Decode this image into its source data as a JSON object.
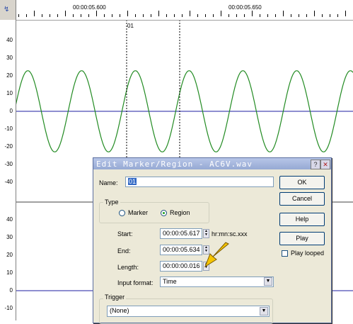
{
  "ruler": {
    "corner_icon": "cursor-icon",
    "time_labels": [
      "00:00:05.600",
      "00:00:05.650"
    ],
    "marker_label": "01"
  },
  "waveform": {
    "top_axis": [
      "40",
      "30",
      "20",
      "10",
      "0",
      "-10",
      "-20",
      "-30",
      "-40"
    ],
    "bottom_axis": [
      "40",
      "30",
      "20",
      "10",
      "0",
      "-10"
    ],
    "wave_color": "#228b22",
    "baseline_color": "#1e1ea0",
    "amplitude_peak": 23
  },
  "dialog": {
    "title": "Edit Marker/Region - AC6V.wav",
    "name_label": "Name:",
    "name_value": "01",
    "type_group": "Type",
    "type_options": [
      "Marker",
      "Region"
    ],
    "type_selected": "Region",
    "start_label": "Start:",
    "start_value": "00:00:05.617",
    "start_hint": "hr:mn:sc.xxx",
    "end_label": "End:",
    "end_value": "00:00:05.634",
    "length_label": "Length:",
    "length_value": "00:00:00.016",
    "input_format_label": "Input format:",
    "input_format_value": "Time",
    "trigger_group": "Trigger",
    "trigger_value": "(None)",
    "buttons": {
      "ok": "OK",
      "cancel": "Cancel",
      "help": "Help",
      "play": "Play"
    },
    "play_looped_label": "Play looped",
    "annotation_arrow_color": "#f5c400"
  }
}
